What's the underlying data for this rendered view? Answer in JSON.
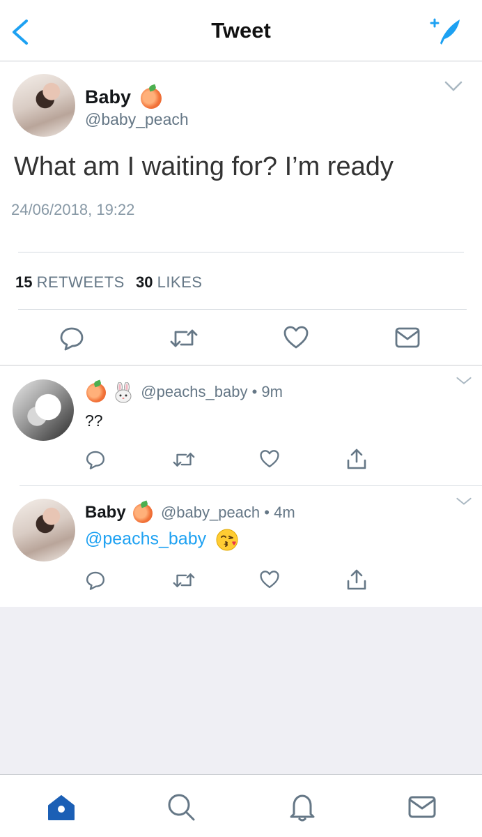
{
  "header": {
    "title": "Tweet"
  },
  "main_tweet": {
    "name": "Baby",
    "handle": "@baby_peach",
    "text": "What am I waiting for? I’m ready",
    "timestamp": "24/06/2018, 19:22",
    "retweets_count": "15",
    "retweets_label": "RETWEETS",
    "likes_count": "30",
    "likes_label": "LIKES"
  },
  "replies": [
    {
      "handle": "@peachs_baby",
      "time": "9m",
      "text": "??"
    },
    {
      "name": "Baby",
      "handle": "@baby_peach",
      "time": "4m",
      "mention": "@peachs_baby"
    }
  ],
  "dot": "•",
  "colors": {
    "accent": "#1da1f2",
    "icon_gray": "#657786",
    "tab_active": "#1b5fb5"
  },
  "tabbar": [
    "home-icon",
    "search-icon",
    "notifications-icon",
    "messages-icon"
  ]
}
